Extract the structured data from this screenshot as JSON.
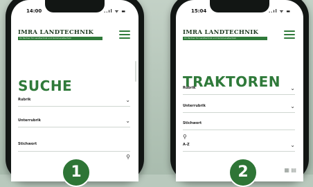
{
  "screens": [
    {
      "time": "14:00",
      "status_icons": "..ıl ᯤ ▬",
      "logo": {
        "title": "IMRA LANDTECHNIK",
        "tagline": "Ihr Partner für Landtechnik und Kommunaltechnik"
      },
      "title": "SUCHE",
      "fields": [
        {
          "label": "Rubrik"
        },
        {
          "label": "Unterrubrik"
        }
      ],
      "search_label": "Stichwort",
      "step": "1"
    },
    {
      "time": "15:04",
      "status_icons": "..ıl ᯤ ▬",
      "logo": {
        "title": "IMRA LANDTECHNIK",
        "tagline": "Ihr Partner für Landtechnik und Kommunaltechnik"
      },
      "title": "TRAKTOREN",
      "fields": [
        {
          "label": "Rubrik"
        },
        {
          "label": "Unterrubrik"
        }
      ],
      "search_label": "Stichwort",
      "sort_label": "A-Z",
      "step": "2"
    }
  ],
  "icons": {
    "search": "search-icon",
    "menu": "hamburger-menu-icon",
    "chevron": "chevron-down-icon"
  },
  "colors": {
    "accent": "#2f7a3a",
    "badge": "#2e7536",
    "background": "#b9c9bd"
  }
}
